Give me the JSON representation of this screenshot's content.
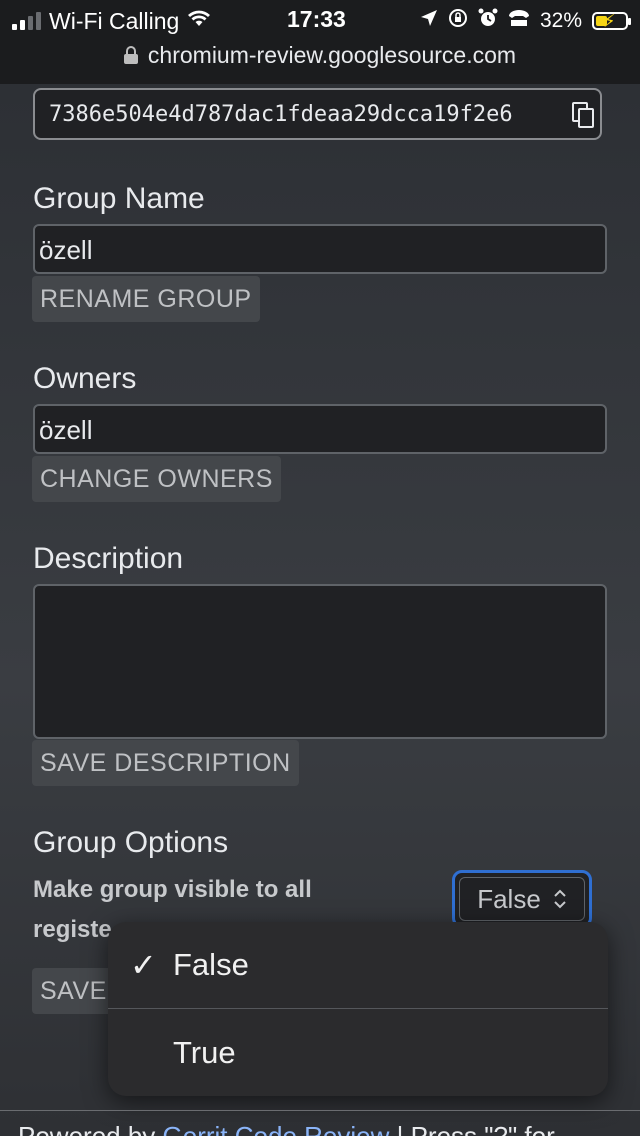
{
  "status_bar": {
    "carrier": "Wi-Fi Calling",
    "time": "17:33",
    "battery": "32%"
  },
  "browser": {
    "url": "chromium-review.googlesource.com"
  },
  "group": {
    "id_value": "7386e504e4d787dac1fdeaa29dcca19f2e6",
    "name_title": "Group Name",
    "name_value": "özell",
    "rename_button": "RENAME GROUP",
    "owners_title": "Owners",
    "owners_value": "özell",
    "change_owners_button": "CHANGE OWNERS",
    "description_title": "Description",
    "description_value": "",
    "save_description_button": "SAVE DESCRIPTION",
    "options_title": "Group Options",
    "visible_label": "Make group visible to all registe",
    "visible_selected": "False",
    "save_options_button": "SAVE"
  },
  "dropdown": {
    "options": [
      {
        "label": "False",
        "selected": true,
        "check": "✓"
      },
      {
        "label": "True",
        "selected": false,
        "check": ""
      }
    ]
  },
  "footer": {
    "powered_by": "Powered by ",
    "link_text": "Gerrit Code Review",
    "hint": " | Press \"?\" for"
  },
  "colors": {
    "accent": "#2f6fd2",
    "link": "#8ab4f8",
    "battery": "#f5d415"
  }
}
